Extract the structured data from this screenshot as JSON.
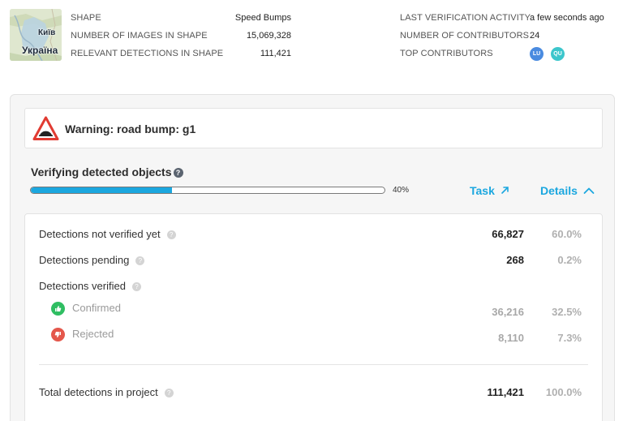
{
  "map": {
    "city": "Київ",
    "country": "Україна"
  },
  "summary": {
    "left": [
      {
        "key": "SHAPE",
        "value": "Speed Bumps"
      },
      {
        "key": "NUMBER OF IMAGES IN SHAPE",
        "value": "15,069,328"
      },
      {
        "key": "RELEVANT DETECTIONS IN SHAPE",
        "value": "111,421"
      }
    ],
    "right": [
      {
        "key": "LAST VERIFICATION ACTIVITY",
        "value": "a few seconds ago"
      },
      {
        "key": "NUMBER OF CONTRIBUTORS",
        "value": "24"
      },
      {
        "key": "TOP CONTRIBUTORS",
        "value": ""
      }
    ],
    "contributors": [
      {
        "initials": "LU",
        "color": "#4a8be0"
      },
      {
        "initials": "QU",
        "color": "#3cc6cc"
      }
    ]
  },
  "warning": {
    "title": "Warning: road bump: g1",
    "accent": "#e13b32"
  },
  "verification": {
    "title": "Verifying detected objects",
    "help": "?",
    "progress": 0.4,
    "progress_label": "40%",
    "task_label": "Task",
    "details_label": "Details",
    "accent": "#1ba7df"
  },
  "detections": {
    "not_verified": {
      "label": "Detections not verified yet",
      "count": "66,827",
      "pct": "60.0%"
    },
    "pending": {
      "label": "Detections pending",
      "count": "268",
      "pct": "0.2%"
    },
    "verified": {
      "label": "Detections verified"
    },
    "confirmed": {
      "label": "Confirmed",
      "count": "36,216",
      "pct": "32.5%"
    },
    "rejected": {
      "label": "Rejected",
      "count": "8,110",
      "pct": "7.3%"
    },
    "total": {
      "label": "Total detections in project",
      "count": "111,421",
      "pct": "100.0%"
    }
  }
}
